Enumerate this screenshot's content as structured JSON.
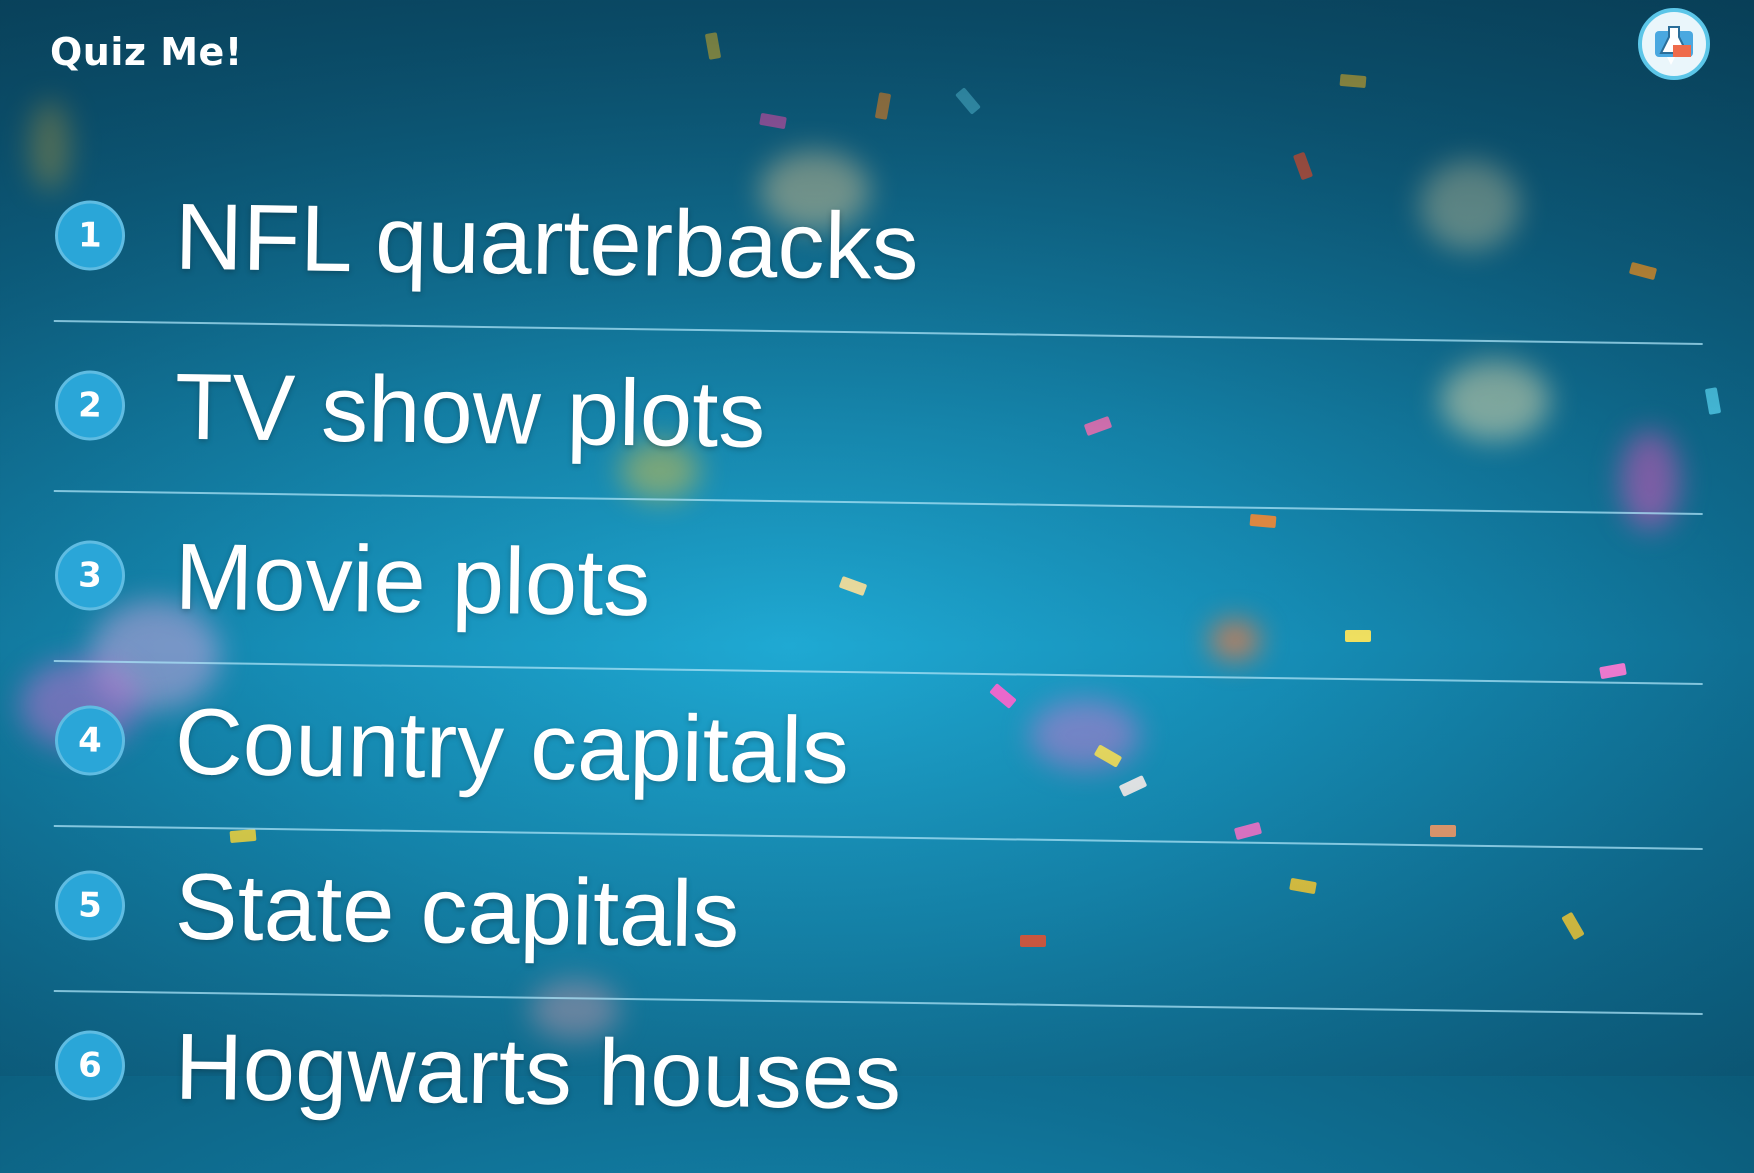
{
  "app": {
    "title": "Quiz Me!"
  },
  "header": {
    "skill_icon": "quiz-skill-icon"
  },
  "menu": {
    "items": [
      {
        "number": "1",
        "label": "NFL quarterbacks"
      },
      {
        "number": "2",
        "label": "TV show plots"
      },
      {
        "number": "3",
        "label": "Movie plots"
      },
      {
        "number": "4",
        "label": "Country capitals"
      },
      {
        "number": "5",
        "label": "State capitals"
      },
      {
        "number": "6",
        "label": "Hogwarts houses"
      }
    ]
  },
  "colors": {
    "background": "#168fb8",
    "number_badge": "#2aa6d8",
    "divider": "#aae1f5",
    "text": "#ffffff"
  }
}
